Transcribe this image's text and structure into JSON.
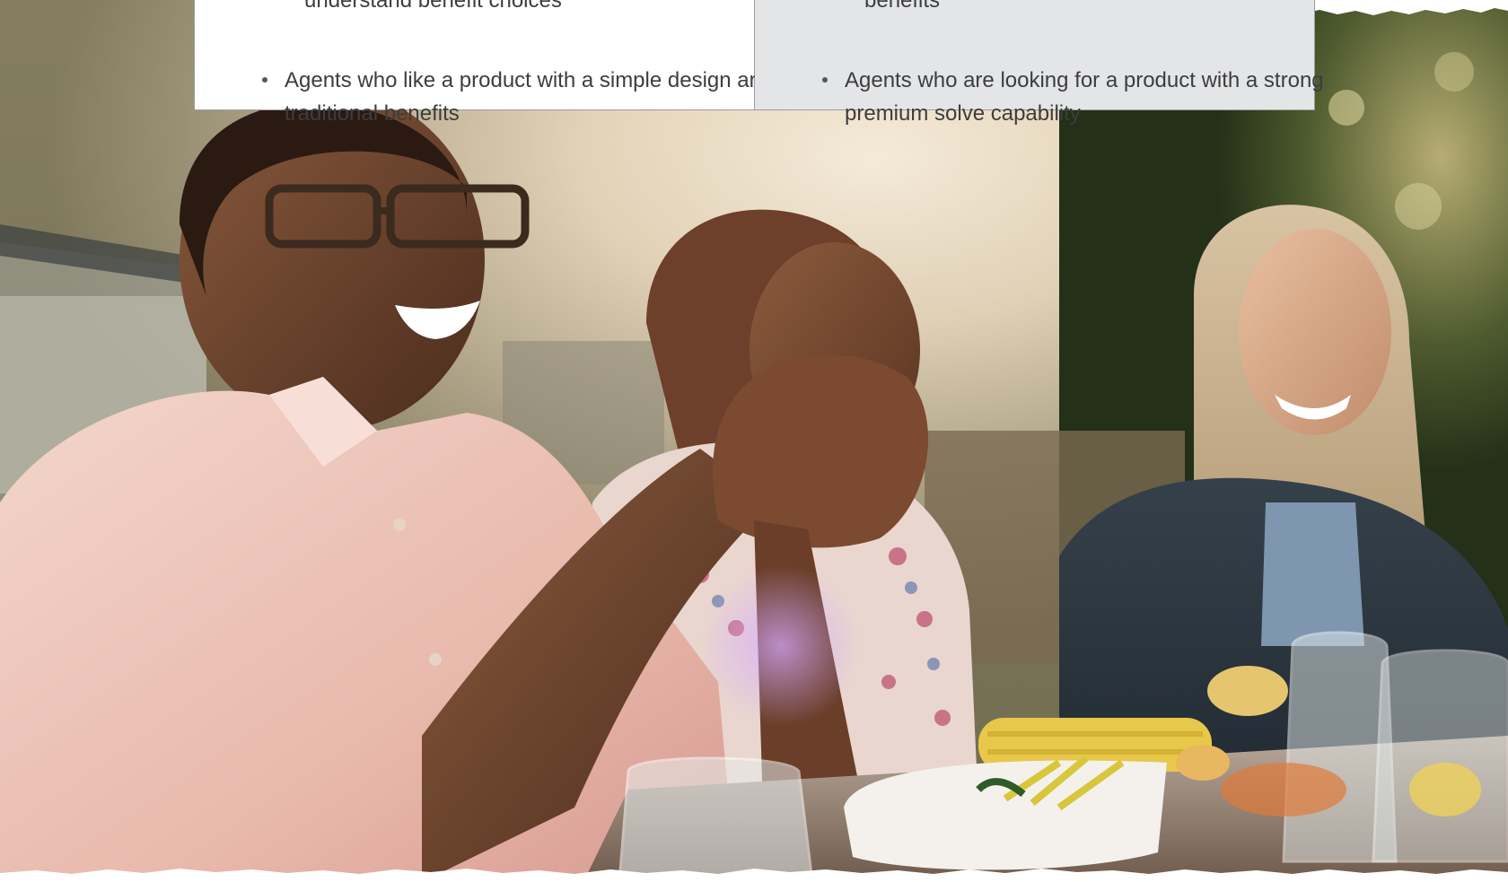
{
  "table": {
    "left_column": {
      "cut_item": "understand benefit choices",
      "item": "Agents who like a product with a simple design and traditional benefits"
    },
    "right_column": {
      "cut_item": "benefits",
      "item": "Agents who are looking for a product with a strong premium solve capability"
    }
  },
  "colors": {
    "right_column_bg": "#e4e5e7",
    "border": "#9c9c9c",
    "text": "#3d3d3d"
  }
}
